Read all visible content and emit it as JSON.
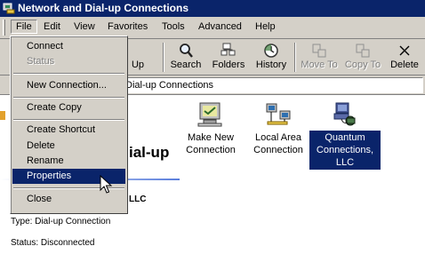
{
  "window": {
    "title": "Network and Dial-up Connections"
  },
  "menubar": [
    "File",
    "Edit",
    "View",
    "Favorites",
    "Tools",
    "Advanced",
    "Help"
  ],
  "toolbar": {
    "up": "Up",
    "search": "Search",
    "folders": "Folders",
    "history": "History",
    "move_to": "Move To",
    "copy_to": "Copy To",
    "delete": "Delete"
  },
  "address": {
    "value": "Dial-up Connections"
  },
  "file_menu": {
    "connect": "Connect",
    "status": "Status",
    "new_connection": "New Connection...",
    "create_copy": "Create Copy",
    "create_shortcut": "Create Shortcut",
    "delete": "Delete",
    "rename": "Rename",
    "properties": "Properties",
    "close": "Close"
  },
  "left_pane": {
    "title_fragment": "ial-up",
    "subtitle_fragment": "LLC",
    "type_line": "Type: Dial-up Connection",
    "status_line": "Status: Disconnected"
  },
  "icons": [
    {
      "line1": "Make New",
      "line2": "Connection"
    },
    {
      "line1": "Local Area",
      "line2": "Connection"
    },
    {
      "line1": "Quantum",
      "line2": "Connections,",
      "line3": "LLC"
    }
  ],
  "colors": {
    "selection": "#0a246a",
    "face": "#d4d0c8"
  }
}
